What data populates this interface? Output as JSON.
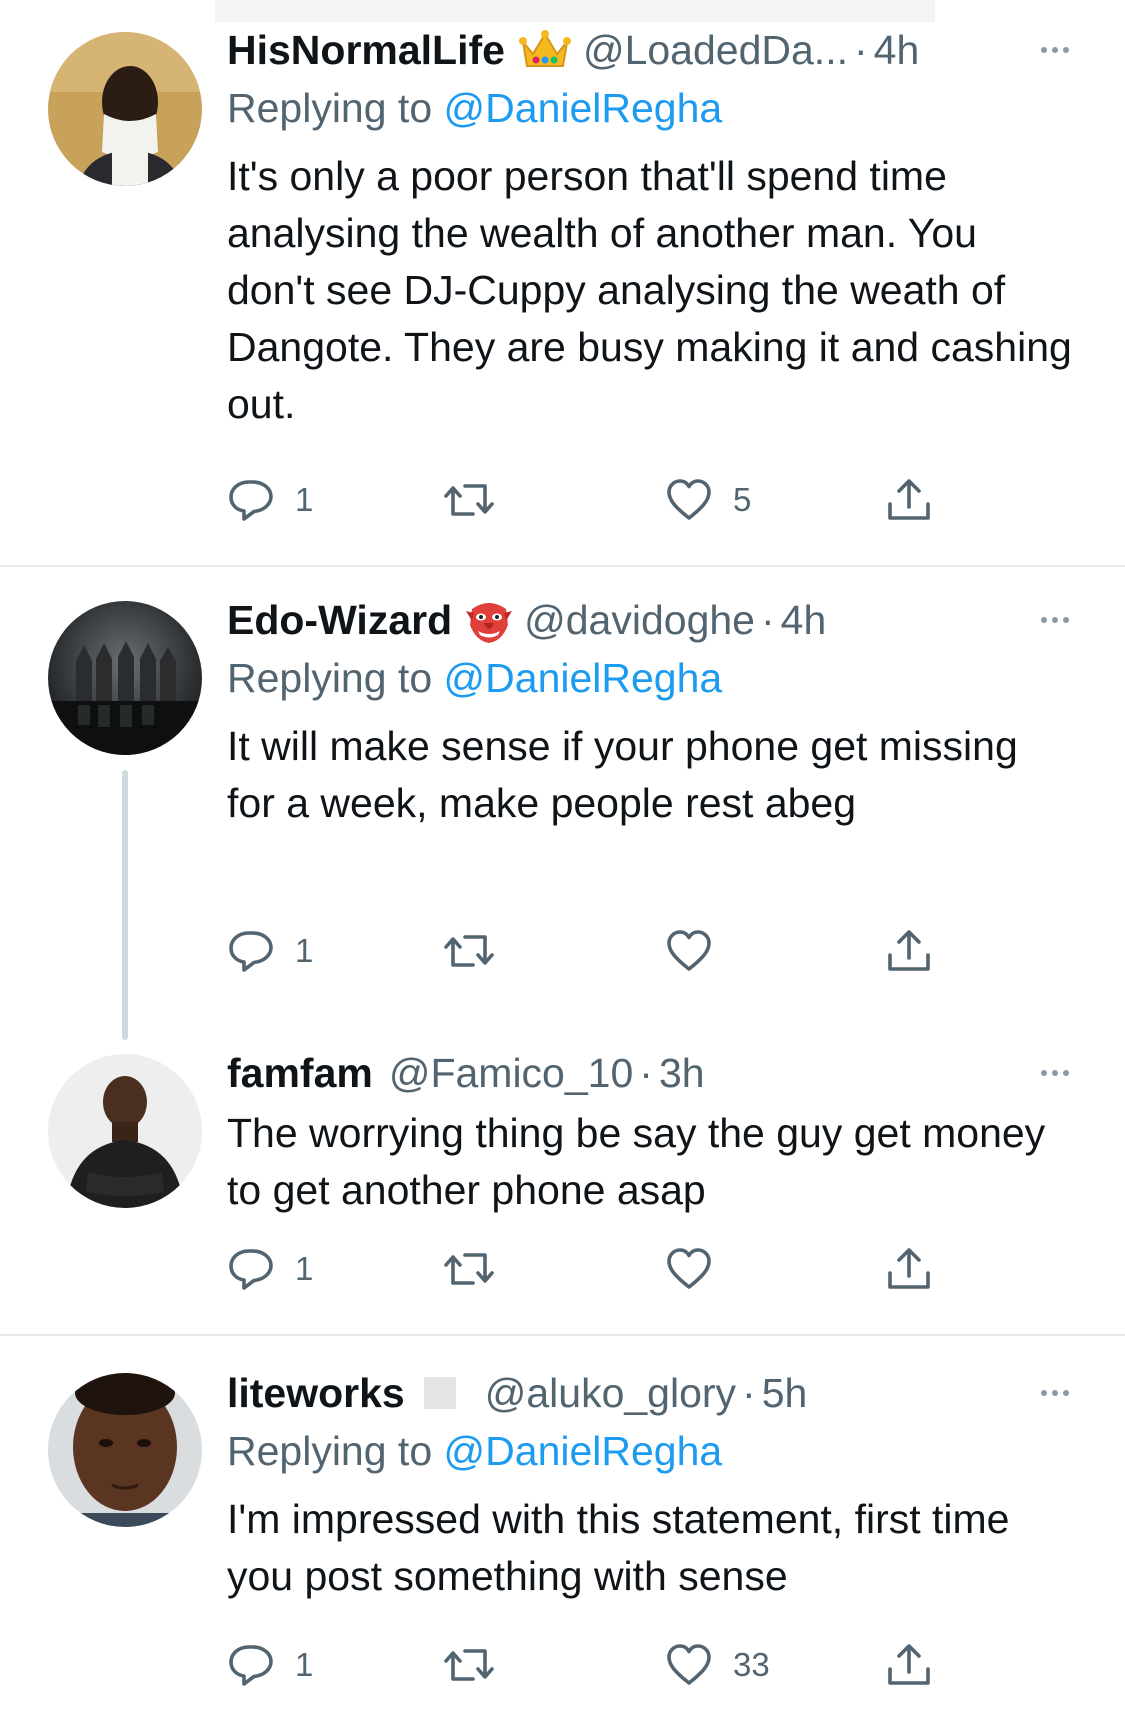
{
  "tweets": [
    {
      "name": "HisNormalLife",
      "badge_icon": "crown-emoji",
      "handle": "@LoadedDa...",
      "separator": "·",
      "time": "4h",
      "replying_prefix": "Replying to",
      "replying_to": "@DanielRegha",
      "text": "It's only a poor person that'll spend time analysing the wealth of another man. You don't see DJ-Cuppy  analysing the weath of Dangote. They are busy making it and cashing out.",
      "replies": "1",
      "retweets": "",
      "likes": "5"
    },
    {
      "name": "Edo-Wizard",
      "badge_icon": "goblin-mask-emoji",
      "handle": "@davidoghe",
      "separator": "·",
      "time": "4h",
      "replying_prefix": "Replying to",
      "replying_to": "@DanielRegha",
      "text": "It will make sense if your phone get missing for a week, make people rest abeg",
      "replies": "1",
      "retweets": "",
      "likes": ""
    },
    {
      "name": "famfam",
      "handle": "@Famico_10",
      "separator": "·",
      "time": "3h",
      "text": "The worrying thing be say the guy get money to get another phone asap",
      "replies": "1",
      "retweets": "",
      "likes": ""
    },
    {
      "name": "liteworks",
      "badge_icon": "white-square-emoji",
      "handle": "@aluko_glory",
      "separator": "·",
      "time": "5h",
      "replying_prefix": "Replying to",
      "replying_to": "@DanielRegha",
      "text": "I'm impressed with this statement, first time you post something with sense",
      "replies": "1",
      "retweets": "",
      "likes": "33"
    }
  ],
  "colors": {
    "text": "#0f1419",
    "secondary": "#536471",
    "link": "#1d9bf0",
    "divider": "#e6e9ea",
    "thread_line": "#cfd9de"
  },
  "icons": [
    "reply-icon",
    "retweet-icon",
    "like-icon",
    "share-icon",
    "more-icon"
  ]
}
